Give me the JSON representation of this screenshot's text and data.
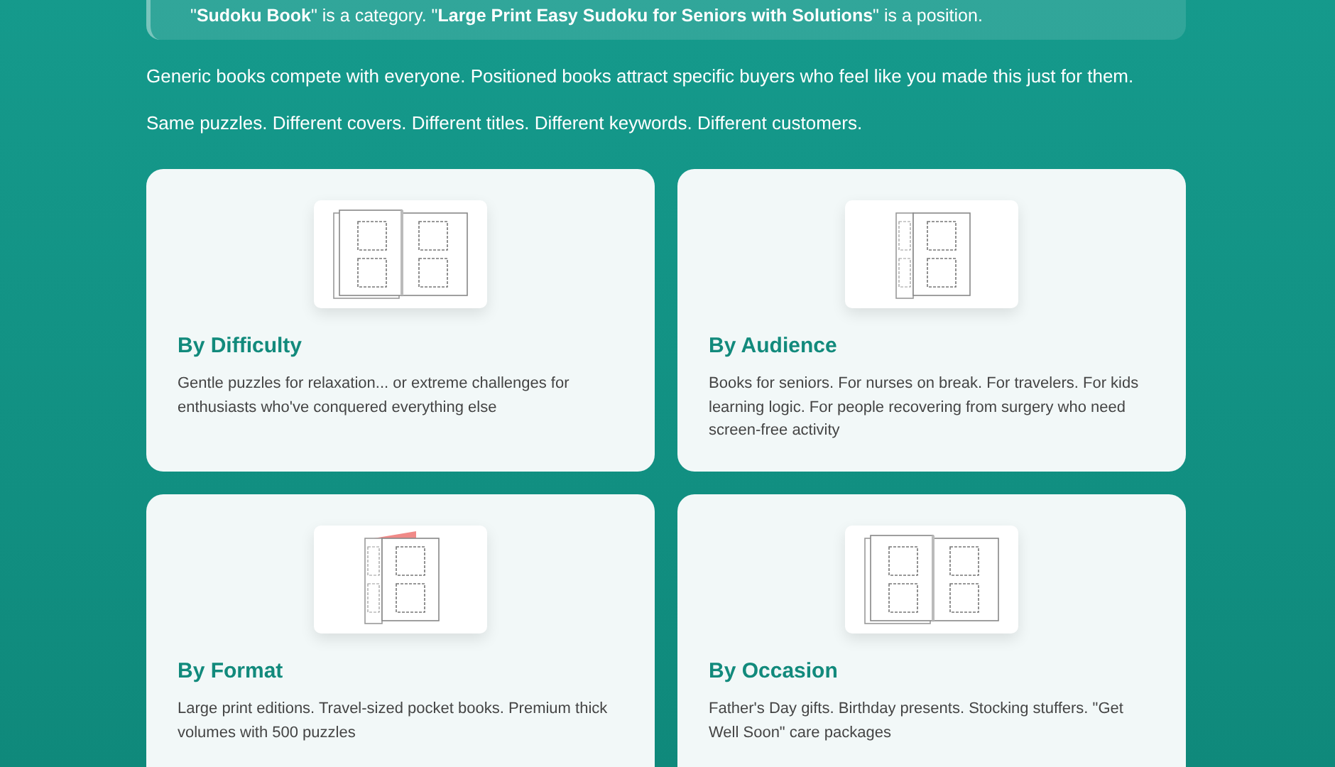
{
  "callout": {
    "text": "\"**Sudoku Book**\" is a category. \"**Large Print Easy Sudoku for Seniors with Solutions**\" is a position."
  },
  "paragraphs": [
    "Generic books compete with everyone. Positioned books attract specific buyers who feel like you made this just for them.",
    "Same puzzles. Different covers. Different titles. Different keywords. Different customers."
  ],
  "cards": [
    {
      "kind": "spread",
      "title": "By Difficulty",
      "description": "Gentle puzzles for relaxation... or extreme challenges for enthusiasts who've conquered everything else"
    },
    {
      "kind": "fold",
      "title": "By Audience",
      "description": "Books for seniors. For nurses on break. For travelers. For kids learning logic. For people recovering from surgery who need screen-free activity"
    },
    {
      "kind": "fold-tab",
      "title": "By Format",
      "description": "Large print editions. Travel-sized pocket books. Premium thick volumes with 500 puzzles"
    },
    {
      "kind": "spread",
      "title": "By Occasion",
      "description": "Father's Day gifts. Birthday presents. Stocking stuffers. \"Get Well Soon\" care packages"
    }
  ]
}
